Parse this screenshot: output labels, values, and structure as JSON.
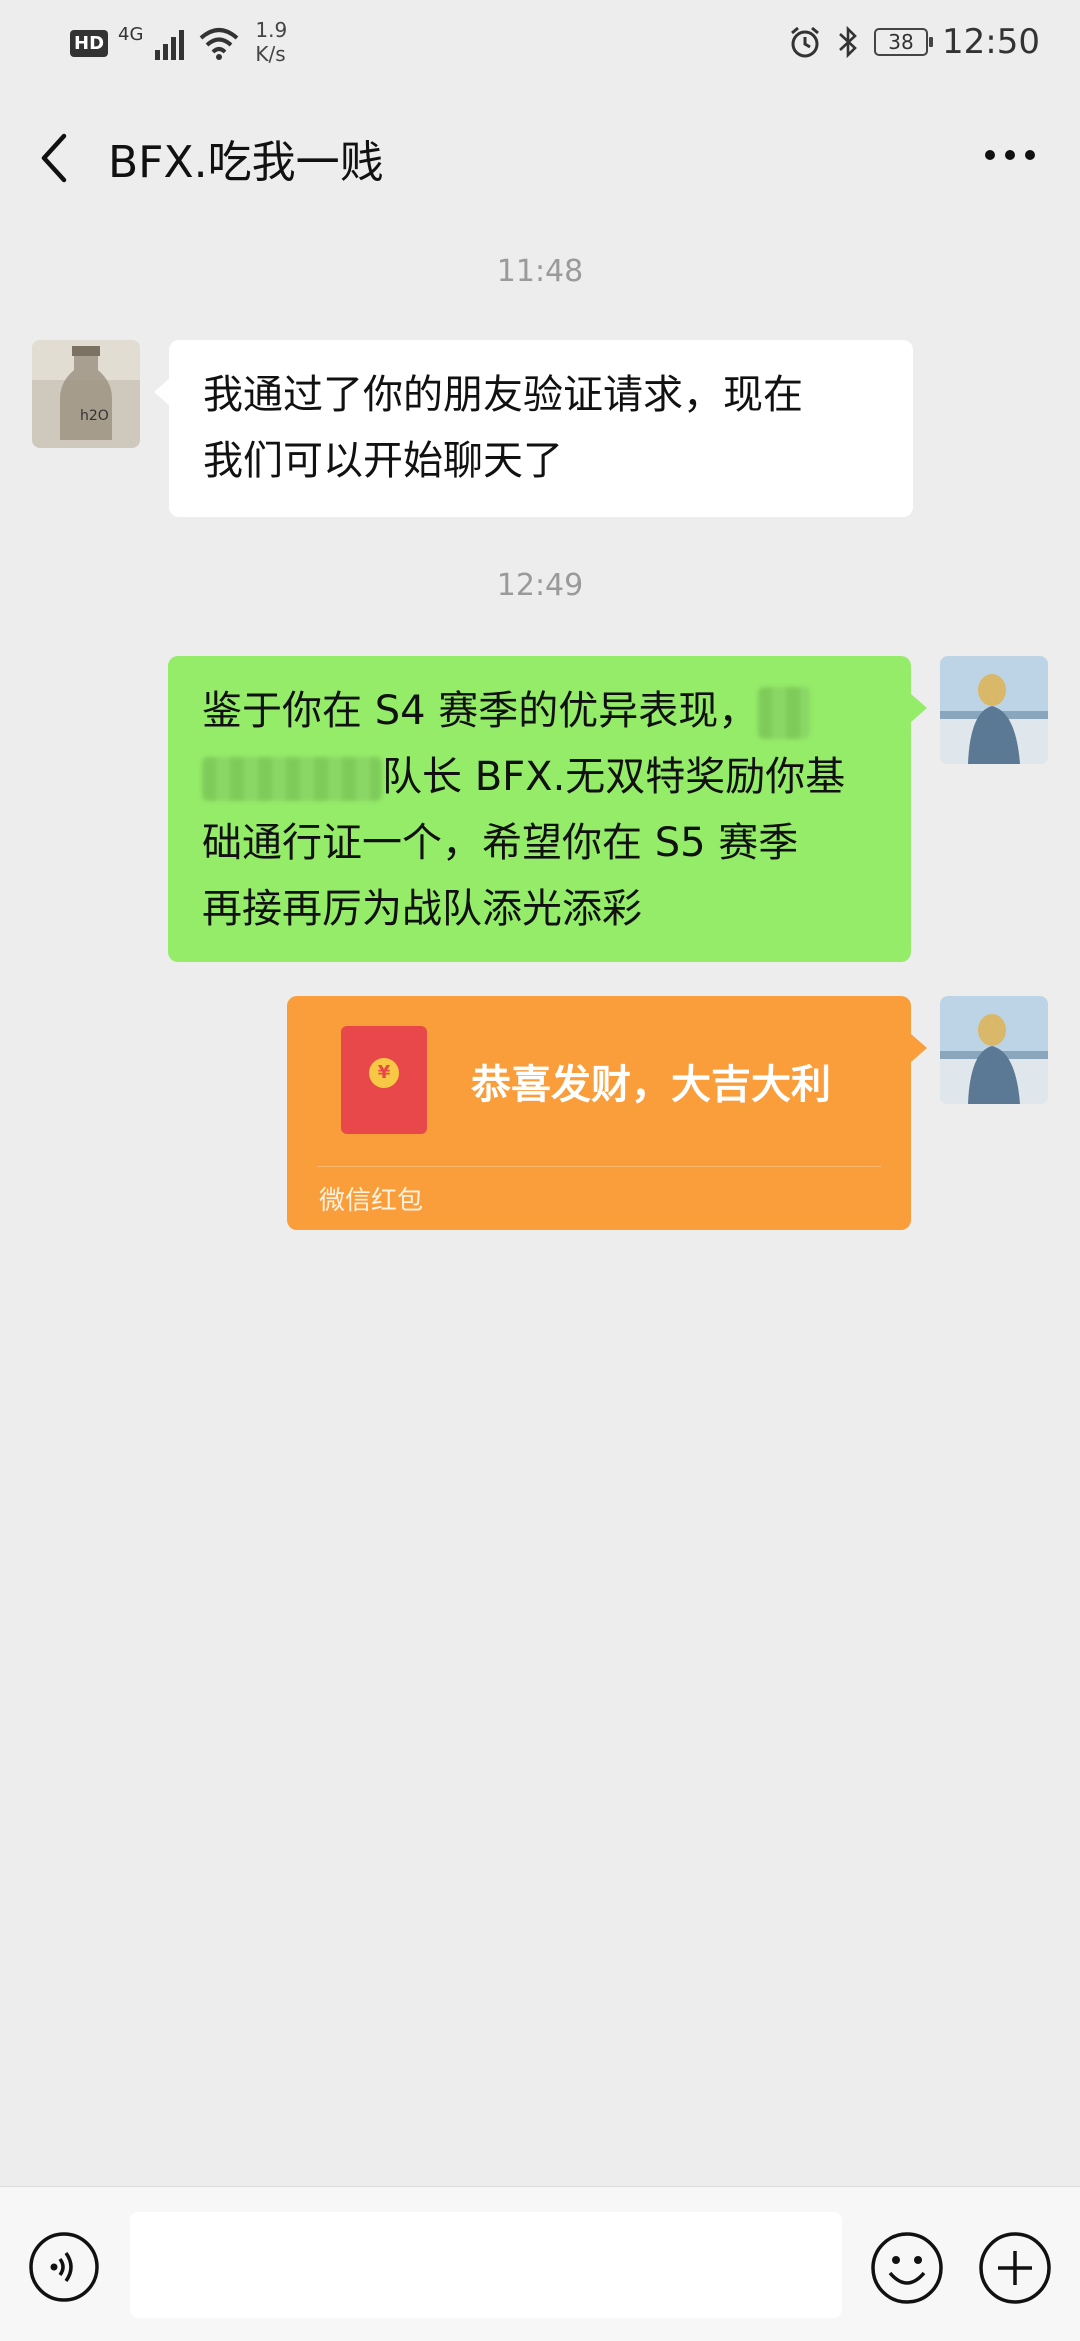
{
  "status_bar": {
    "network_badge": "HD",
    "network_type": "4G",
    "speed_value": "1.9",
    "speed_unit": "K/s",
    "battery": "38",
    "time": "12:50"
  },
  "header": {
    "title": "BFX.吃我一贱"
  },
  "chat": {
    "timestamp_1": "11:48",
    "incoming_line1": "我通过了你的朋友验证请求，现在",
    "incoming_line2": "我们可以开始聊天了",
    "timestamp_2": "12:49",
    "outgoing_line1": "鉴于你在 S4 赛季的优异表现，",
    "outgoing_line2": "队长 BFX.无双特奖励你基",
    "outgoing_line3": "础通行证一个，希望你在 S5 赛季",
    "outgoing_line4": "再接再厉为战队添光添彩",
    "red_packet_title": "恭喜发财，大吉大利",
    "red_packet_label": "微信红包"
  },
  "colors": {
    "background": "#ededed",
    "outgoing_bubble": "#95ec69",
    "incoming_bubble": "#ffffff",
    "red_packet": "#fa9d3b"
  },
  "icons": [
    "alarm-icon",
    "bluetooth-icon",
    "wifi-icon",
    "signal-icon",
    "back-icon",
    "more-icon",
    "voice-icon",
    "emoji-icon",
    "plus-icon"
  ]
}
